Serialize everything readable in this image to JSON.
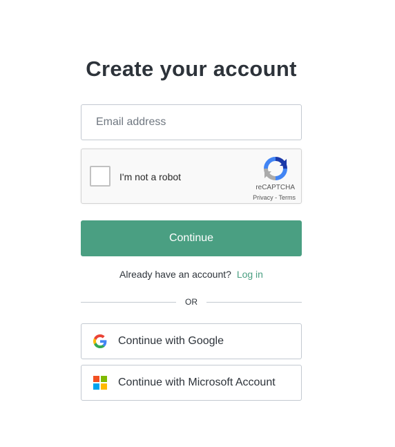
{
  "page": {
    "title": "Create your account"
  },
  "email": {
    "placeholder": "Email address",
    "value": ""
  },
  "recaptcha": {
    "label": "I'm not a robot",
    "brand": "reCAPTCHA",
    "privacy": "Privacy",
    "separator": " - ",
    "terms": "Terms",
    "checked": false
  },
  "continue": {
    "label": "Continue"
  },
  "login": {
    "prompt": "Already have an account?",
    "link": "Log in"
  },
  "divider": {
    "text": "OR"
  },
  "social": {
    "google_label": "Continue with Google",
    "google_icon": "google-icon",
    "microsoft_label": "Continue with Microsoft Account",
    "microsoft_icon": "microsoft-icon"
  },
  "colors": {
    "accent": "#4a9f82",
    "text": "#2d333a",
    "border": "#c2c8d0"
  }
}
